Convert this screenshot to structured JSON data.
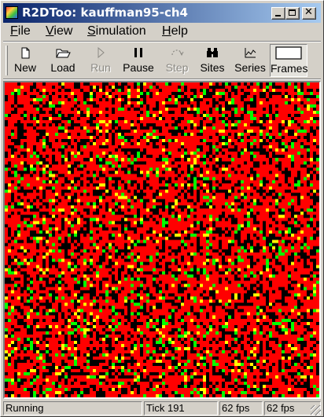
{
  "window": {
    "title": "R2DToo: kauffman95-ch4"
  },
  "menu": [
    {
      "label": "File"
    },
    {
      "label": "View"
    },
    {
      "label": "Simulation"
    },
    {
      "label": "Help"
    }
  ],
  "toolbar": {
    "new": "New",
    "load": "Load",
    "run": "Run",
    "pause": "Pause",
    "step": "Step",
    "sites": "Sites",
    "series": "Series",
    "frames": "Frames"
  },
  "status": {
    "state": "Running",
    "tick": "Tick 191",
    "fps1": "62 fps",
    "fps2": "62 fps"
  },
  "colors": {
    "cell_red": "#ff0000",
    "cell_black": "#000000",
    "cell_green": "#00ff00",
    "cell_yellow": "#ffff00",
    "title_start": "#0a246a",
    "title_end": "#a6caf0"
  },
  "grid": {
    "columns": 100,
    "rows": 100,
    "seed": 191
  }
}
